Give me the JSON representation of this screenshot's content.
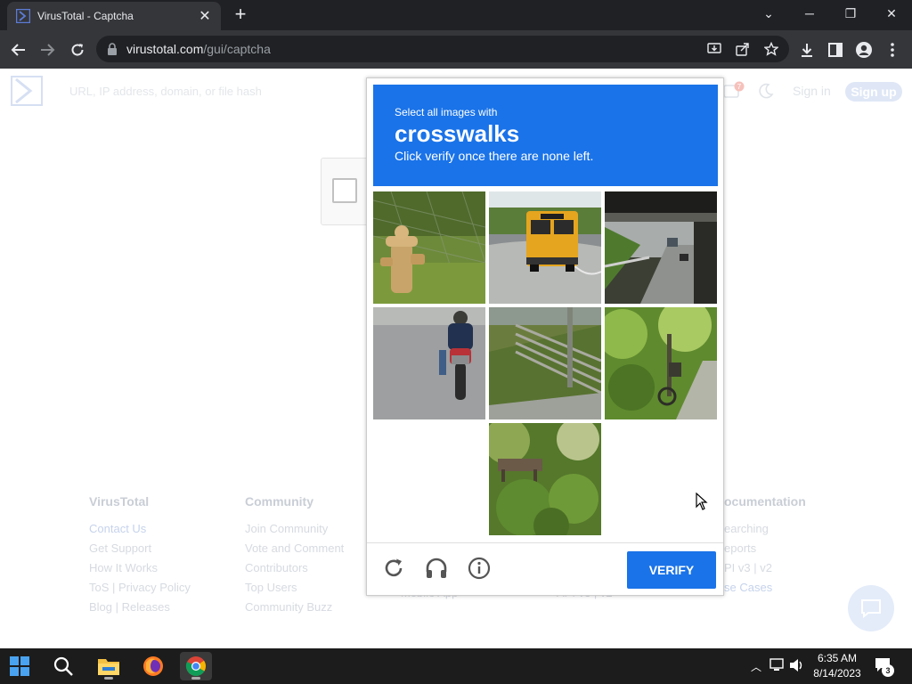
{
  "browser": {
    "tab_title": "VirusTotal - Captcha",
    "url_host": "virustotal.com",
    "url_path": "/gui/captcha"
  },
  "site": {
    "search_placeholder": "URL, IP address, domain, or file hash",
    "notification_count": "7",
    "sign_in": "Sign in",
    "sign_up": "Sign up"
  },
  "footer": {
    "columns": [
      {
        "heading": "VirusTotal",
        "links": [
          "Contact Us",
          "Get Support",
          "How It Works",
          "ToS | Privacy Policy",
          "Blog | Releases"
        ]
      },
      {
        "heading": "Community",
        "links": [
          "Join Community",
          "Vote and Comment",
          "Contributors",
          "Top Users",
          "Community Buzz"
        ]
      },
      {
        "heading": "",
        "links": [
          "",
          "",
          "",
          "",
          "Mobile App"
        ]
      },
      {
        "heading": "",
        "links": [
          "",
          "",
          "",
          "",
          "API v3 | v2"
        ]
      },
      {
        "heading": "ocumentation",
        "links": [
          "earching",
          "eports",
          "PI v3 | v2",
          "se Cases",
          ""
        ]
      }
    ]
  },
  "captcha": {
    "line1": "Select all images with",
    "target_word": "crosswalks",
    "line3": "Click verify once there are none left.",
    "verify_label": "VERIFY",
    "tiles": [
      {
        "subject": "fire hydrant",
        "empty": false
      },
      {
        "subject": "school bus",
        "empty": false
      },
      {
        "subject": "road under bridge",
        "empty": false
      },
      {
        "subject": "motorcycle",
        "empty": false
      },
      {
        "subject": "stairs",
        "empty": false
      },
      {
        "subject": "bicycle in foliage",
        "empty": false
      },
      {
        "subject": "",
        "empty": true
      },
      {
        "subject": "bushes and bench",
        "empty": false
      },
      {
        "subject": "",
        "empty": true
      }
    ]
  },
  "taskbar": {
    "time": "6:35 AM",
    "date": "8/14/2023",
    "notification_count": "3"
  }
}
